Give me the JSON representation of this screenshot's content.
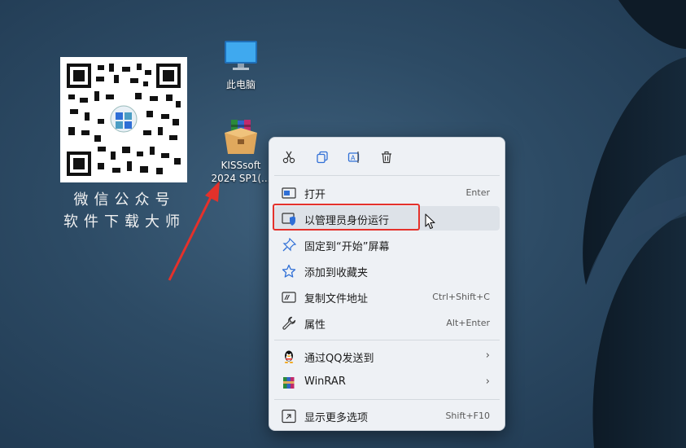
{
  "desktop": {
    "icons": [
      {
        "label": "此电脑",
        "icon": "monitor-icon"
      },
      {
        "label_line1": "KISSsoft",
        "label_line2": "2024 SP1(...",
        "icon": "winrar-archive-icon"
      }
    ],
    "watermark": {
      "line1": "微信公众号",
      "line2": "软件下载大师"
    }
  },
  "context_menu": {
    "toolbar": [
      {
        "name": "cut",
        "icon": "scissors-icon"
      },
      {
        "name": "copy",
        "icon": "copy-icon"
      },
      {
        "name": "rename",
        "icon": "rename-icon"
      },
      {
        "name": "delete",
        "icon": "trash-icon"
      }
    ],
    "items": [
      {
        "label": "打开",
        "shortcut": "Enter",
        "icon": "open-icon"
      },
      {
        "label": "以管理员身份运行",
        "shortcut": "",
        "icon": "shield-icon"
      },
      {
        "label": "固定到“开始”屏幕",
        "shortcut": "",
        "icon": "pin-icon"
      },
      {
        "label": "添加到收藏夹",
        "shortcut": "",
        "icon": "star-icon"
      },
      {
        "label": "复制文件地址",
        "shortcut": "Ctrl+Shift+C",
        "icon": "copy-path-icon"
      },
      {
        "label": "属性",
        "shortcut": "Alt+Enter",
        "icon": "wrench-icon"
      },
      {
        "label": "通过QQ发送到",
        "shortcut": "",
        "icon": "qq-penguin-icon",
        "submenu": "›"
      },
      {
        "label": "WinRAR",
        "shortcut": "",
        "icon": "winrar-icon",
        "submenu": "›"
      },
      {
        "label": "显示更多选项",
        "shortcut": "Shift+F10",
        "icon": "more-options-icon"
      }
    ]
  },
  "colors": {
    "highlight": "#e4312b",
    "accent": "#2f6fd6",
    "menu_bg": "#eef1f5"
  }
}
